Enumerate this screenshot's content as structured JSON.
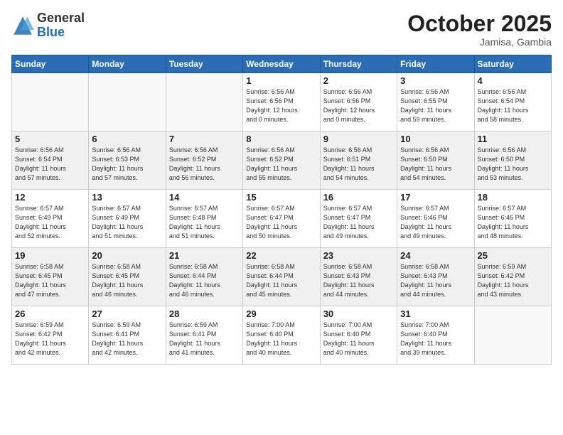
{
  "header": {
    "logo_general": "General",
    "logo_blue": "Blue",
    "month": "October 2025",
    "location": "Jamisa, Gambia"
  },
  "days_of_week": [
    "Sunday",
    "Monday",
    "Tuesday",
    "Wednesday",
    "Thursday",
    "Friday",
    "Saturday"
  ],
  "weeks": [
    [
      {
        "day": "",
        "info": ""
      },
      {
        "day": "",
        "info": ""
      },
      {
        "day": "",
        "info": ""
      },
      {
        "day": "1",
        "info": "Sunrise: 6:56 AM\nSunset: 6:56 PM\nDaylight: 12 hours\nand 0 minutes."
      },
      {
        "day": "2",
        "info": "Sunrise: 6:56 AM\nSunset: 6:56 PM\nDaylight: 12 hours\nand 0 minutes."
      },
      {
        "day": "3",
        "info": "Sunrise: 6:56 AM\nSunset: 6:55 PM\nDaylight: 11 hours\nand 59 minutes."
      },
      {
        "day": "4",
        "info": "Sunrise: 6:56 AM\nSunset: 6:54 PM\nDaylight: 11 hours\nand 58 minutes."
      }
    ],
    [
      {
        "day": "5",
        "info": "Sunrise: 6:56 AM\nSunset: 6:54 PM\nDaylight: 11 hours\nand 57 minutes."
      },
      {
        "day": "6",
        "info": "Sunrise: 6:56 AM\nSunset: 6:53 PM\nDaylight: 11 hours\nand 57 minutes."
      },
      {
        "day": "7",
        "info": "Sunrise: 6:56 AM\nSunset: 6:52 PM\nDaylight: 11 hours\nand 56 minutes."
      },
      {
        "day": "8",
        "info": "Sunrise: 6:56 AM\nSunset: 6:52 PM\nDaylight: 11 hours\nand 55 minutes."
      },
      {
        "day": "9",
        "info": "Sunrise: 6:56 AM\nSunset: 6:51 PM\nDaylight: 11 hours\nand 54 minutes."
      },
      {
        "day": "10",
        "info": "Sunrise: 6:56 AM\nSunset: 6:50 PM\nDaylight: 11 hours\nand 54 minutes."
      },
      {
        "day": "11",
        "info": "Sunrise: 6:56 AM\nSunset: 6:50 PM\nDaylight: 11 hours\nand 53 minutes."
      }
    ],
    [
      {
        "day": "12",
        "info": "Sunrise: 6:57 AM\nSunset: 6:49 PM\nDaylight: 11 hours\nand 52 minutes."
      },
      {
        "day": "13",
        "info": "Sunrise: 6:57 AM\nSunset: 6:49 PM\nDaylight: 11 hours\nand 51 minutes."
      },
      {
        "day": "14",
        "info": "Sunrise: 6:57 AM\nSunset: 6:48 PM\nDaylight: 11 hours\nand 51 minutes."
      },
      {
        "day": "15",
        "info": "Sunrise: 6:57 AM\nSunset: 6:47 PM\nDaylight: 11 hours\nand 50 minutes."
      },
      {
        "day": "16",
        "info": "Sunrise: 6:57 AM\nSunset: 6:47 PM\nDaylight: 11 hours\nand 49 minutes."
      },
      {
        "day": "17",
        "info": "Sunrise: 6:57 AM\nSunset: 6:46 PM\nDaylight: 11 hours\nand 49 minutes."
      },
      {
        "day": "18",
        "info": "Sunrise: 6:57 AM\nSunset: 6:46 PM\nDaylight: 11 hours\nand 48 minutes."
      }
    ],
    [
      {
        "day": "19",
        "info": "Sunrise: 6:58 AM\nSunset: 6:45 PM\nDaylight: 11 hours\nand 47 minutes."
      },
      {
        "day": "20",
        "info": "Sunrise: 6:58 AM\nSunset: 6:45 PM\nDaylight: 11 hours\nand 46 minutes."
      },
      {
        "day": "21",
        "info": "Sunrise: 6:58 AM\nSunset: 6:44 PM\nDaylight: 11 hours\nand 46 minutes."
      },
      {
        "day": "22",
        "info": "Sunrise: 6:58 AM\nSunset: 6:44 PM\nDaylight: 11 hours\nand 45 minutes."
      },
      {
        "day": "23",
        "info": "Sunrise: 6:58 AM\nSunset: 6:43 PM\nDaylight: 11 hours\nand 44 minutes."
      },
      {
        "day": "24",
        "info": "Sunrise: 6:58 AM\nSunset: 6:43 PM\nDaylight: 11 hours\nand 44 minutes."
      },
      {
        "day": "25",
        "info": "Sunrise: 6:59 AM\nSunset: 6:42 PM\nDaylight: 11 hours\nand 43 minutes."
      }
    ],
    [
      {
        "day": "26",
        "info": "Sunrise: 6:59 AM\nSunset: 6:42 PM\nDaylight: 11 hours\nand 42 minutes."
      },
      {
        "day": "27",
        "info": "Sunrise: 6:59 AM\nSunset: 6:41 PM\nDaylight: 11 hours\nand 42 minutes."
      },
      {
        "day": "28",
        "info": "Sunrise: 6:59 AM\nSunset: 6:41 PM\nDaylight: 11 hours\nand 41 minutes."
      },
      {
        "day": "29",
        "info": "Sunrise: 7:00 AM\nSunset: 6:40 PM\nDaylight: 11 hours\nand 40 minutes."
      },
      {
        "day": "30",
        "info": "Sunrise: 7:00 AM\nSunset: 6:40 PM\nDaylight: 11 hours\nand 40 minutes."
      },
      {
        "day": "31",
        "info": "Sunrise: 7:00 AM\nSunset: 6:40 PM\nDaylight: 11 hours\nand 39 minutes."
      },
      {
        "day": "",
        "info": ""
      }
    ]
  ]
}
